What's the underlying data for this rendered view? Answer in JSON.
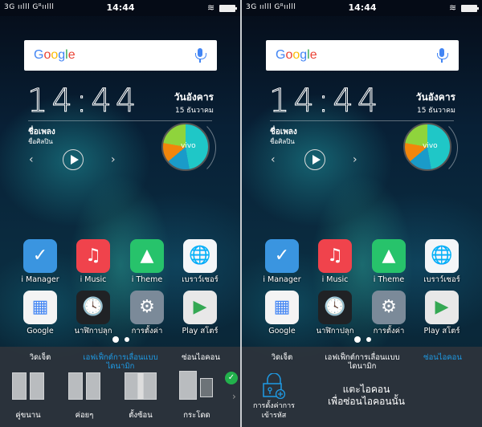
{
  "status_bar": {
    "left": "3G ıılll Gᴿıılll",
    "time": "14:44",
    "wifi_icon": "wifi-icon",
    "battery_icon": "battery-charging-icon"
  },
  "search": {
    "logo": "Google",
    "mic_icon": "mic-icon"
  },
  "clock_widget": {
    "time": "14:44",
    "day": "วันอังคาร",
    "date": "15 ธันวาคม"
  },
  "music_widget": {
    "song": "ชื่อเพลง",
    "artist": "ชื่อศิลปิน",
    "prev": "‹",
    "next": "›",
    "brand": "vivo"
  },
  "apps": [
    {
      "label": "i Manager",
      "icon": "shield-check-icon",
      "bg": "#3a95e0",
      "glyph": "✓"
    },
    {
      "label": "i Music",
      "icon": "music-note-icon",
      "bg": "#f0434c",
      "glyph": "♫"
    },
    {
      "label": "i Theme",
      "icon": "theme-icon",
      "bg": "#27c36b",
      "glyph": "▲"
    },
    {
      "label": "เบราว์เซอร์",
      "icon": "globe-icon",
      "bg": "#f4f6f8",
      "glyph": "🌐"
    },
    {
      "label": "Google",
      "icon": "google-folder-icon",
      "bg": "#f4f4f4",
      "glyph": "▦"
    },
    {
      "label": "นาฬิกาปลุก",
      "icon": "clock-icon",
      "bg": "#202225",
      "glyph": "🕓"
    },
    {
      "label": "การตั้งค่า",
      "icon": "gear-icon",
      "bg": "#7b8a99",
      "glyph": "⚙"
    },
    {
      "label": "Play สโตร์",
      "icon": "play-store-icon",
      "bg": "#e8e8e8",
      "glyph": "▶"
    }
  ],
  "page_indicator": {
    "current": 1,
    "total": 2
  },
  "dock_tabs": {
    "widgets": "วิดเจ็ต",
    "effects": "เอฟเฟ็กต์การเลื่อนแบบ\nไดนามิก",
    "hide": "ซ่อนไอคอน"
  },
  "accent": "#1e9be6",
  "screens": [
    {
      "active_tab": "effects",
      "effects": [
        {
          "label": "คู่ขนาน"
        },
        {
          "label": "ค่อยๆ"
        },
        {
          "label": "ตั้งซ้อน"
        },
        {
          "label": "กระโดด",
          "selected": true
        }
      ],
      "more_icon": "chevron-right-icon"
    },
    {
      "active_tab": "hide",
      "lock_label": "การตั้งค่าการ\nเข้ารหัส",
      "hint_line1": "แตะไอคอน",
      "hint_line2": "เพื่อซ่อนไอคอนนั้น"
    }
  ]
}
